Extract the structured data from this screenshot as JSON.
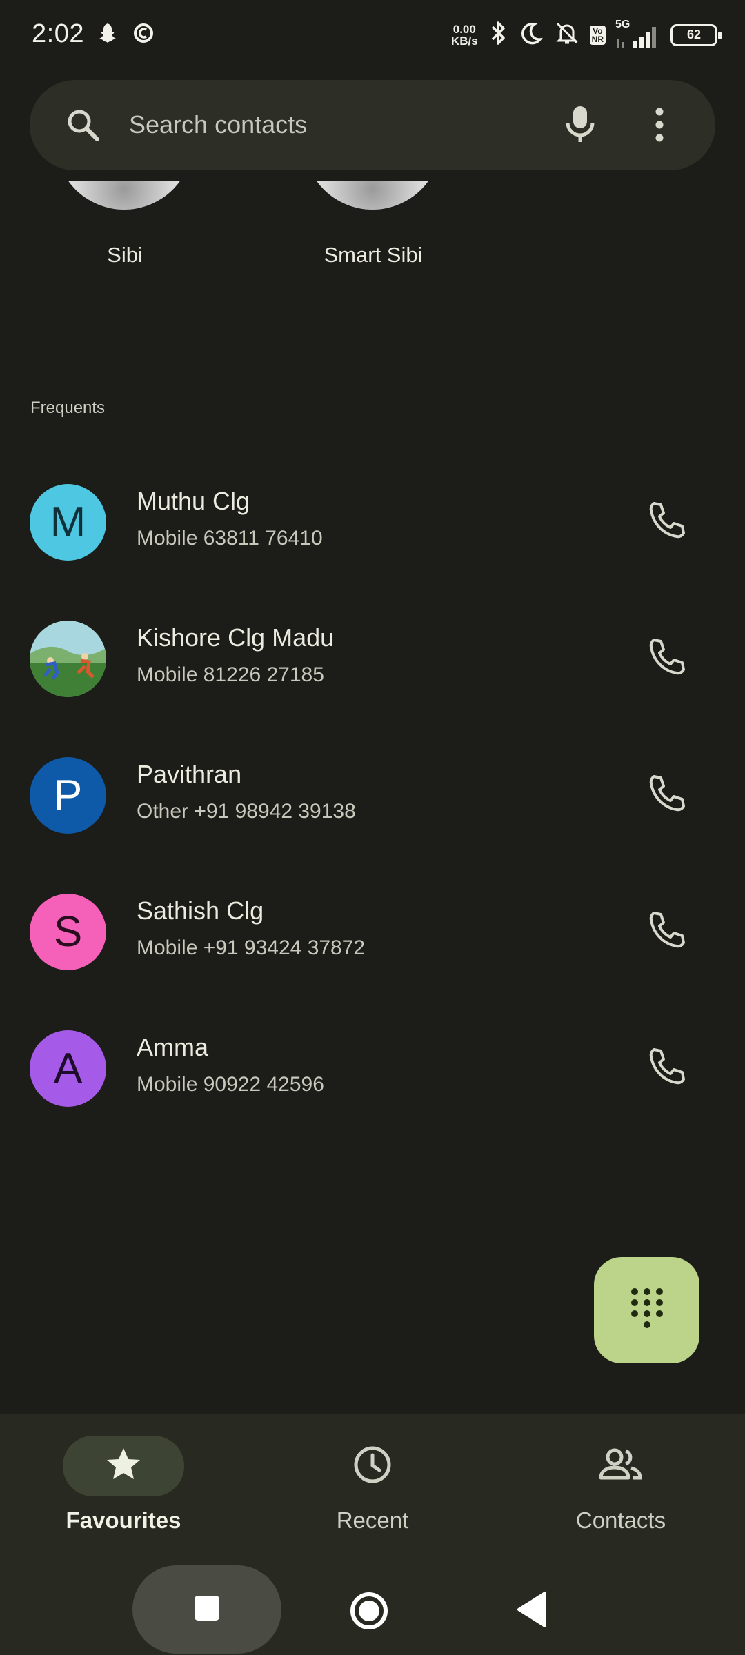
{
  "status_bar": {
    "time": "2:02",
    "net_speed_value": "0.00",
    "net_speed_unit": "KB/s",
    "volte_badge_top": "Vo",
    "volte_badge_bottom": "NR",
    "network_type": "5G",
    "battery_level": "62",
    "icons": [
      "snapchat-icon",
      "cred-icon",
      "bluetooth-icon",
      "do-not-disturb-icon",
      "muted-bell-icon",
      "signal-icon"
    ]
  },
  "search": {
    "placeholder": "Search contacts",
    "icons": [
      "search-icon",
      "mic-icon",
      "more-vert-icon"
    ]
  },
  "favourites": [
    {
      "name": "Sibi"
    },
    {
      "name": "Smart Sibi"
    }
  ],
  "frequents": {
    "title": "Frequents",
    "items": [
      {
        "initial": "M",
        "name": "Muthu Clg",
        "detail": "Mobile 63811 76410",
        "avatar_color": "#4ec8e2",
        "initial_color": "#10303a"
      },
      {
        "initial": "",
        "name": "Kishore Clg Madu",
        "detail": "Mobile 81226 27185",
        "avatar_color": "#6da36a",
        "initial_color": "#ffffff"
      },
      {
        "initial": "P",
        "name": "Pavithran",
        "detail": "Other +91 98942 39138",
        "avatar_color": "#0e5aa8",
        "initial_color": "#ffffff"
      },
      {
        "initial": "S",
        "name": "Sathish Clg",
        "detail": "Mobile +91 93424 37872",
        "avatar_color": "#f560b8",
        "initial_color": "#2a0e1f"
      },
      {
        "initial": "A",
        "name": "Amma",
        "detail": "Mobile 90922 42596",
        "avatar_color": "#a65ae8",
        "initial_color": "#1e0c2d"
      }
    ]
  },
  "fab": {
    "icon": "dialpad-icon",
    "color": "#bcd48a"
  },
  "bottom_nav": [
    {
      "label": "Favourites",
      "icon": "star-icon",
      "active": true
    },
    {
      "label": "Recent",
      "icon": "clock-icon",
      "active": false
    },
    {
      "label": "Contacts",
      "icon": "people-icon",
      "active": false
    }
  ],
  "system_nav": [
    "recents-square-icon",
    "home-circle-icon",
    "back-triangle-icon"
  ]
}
